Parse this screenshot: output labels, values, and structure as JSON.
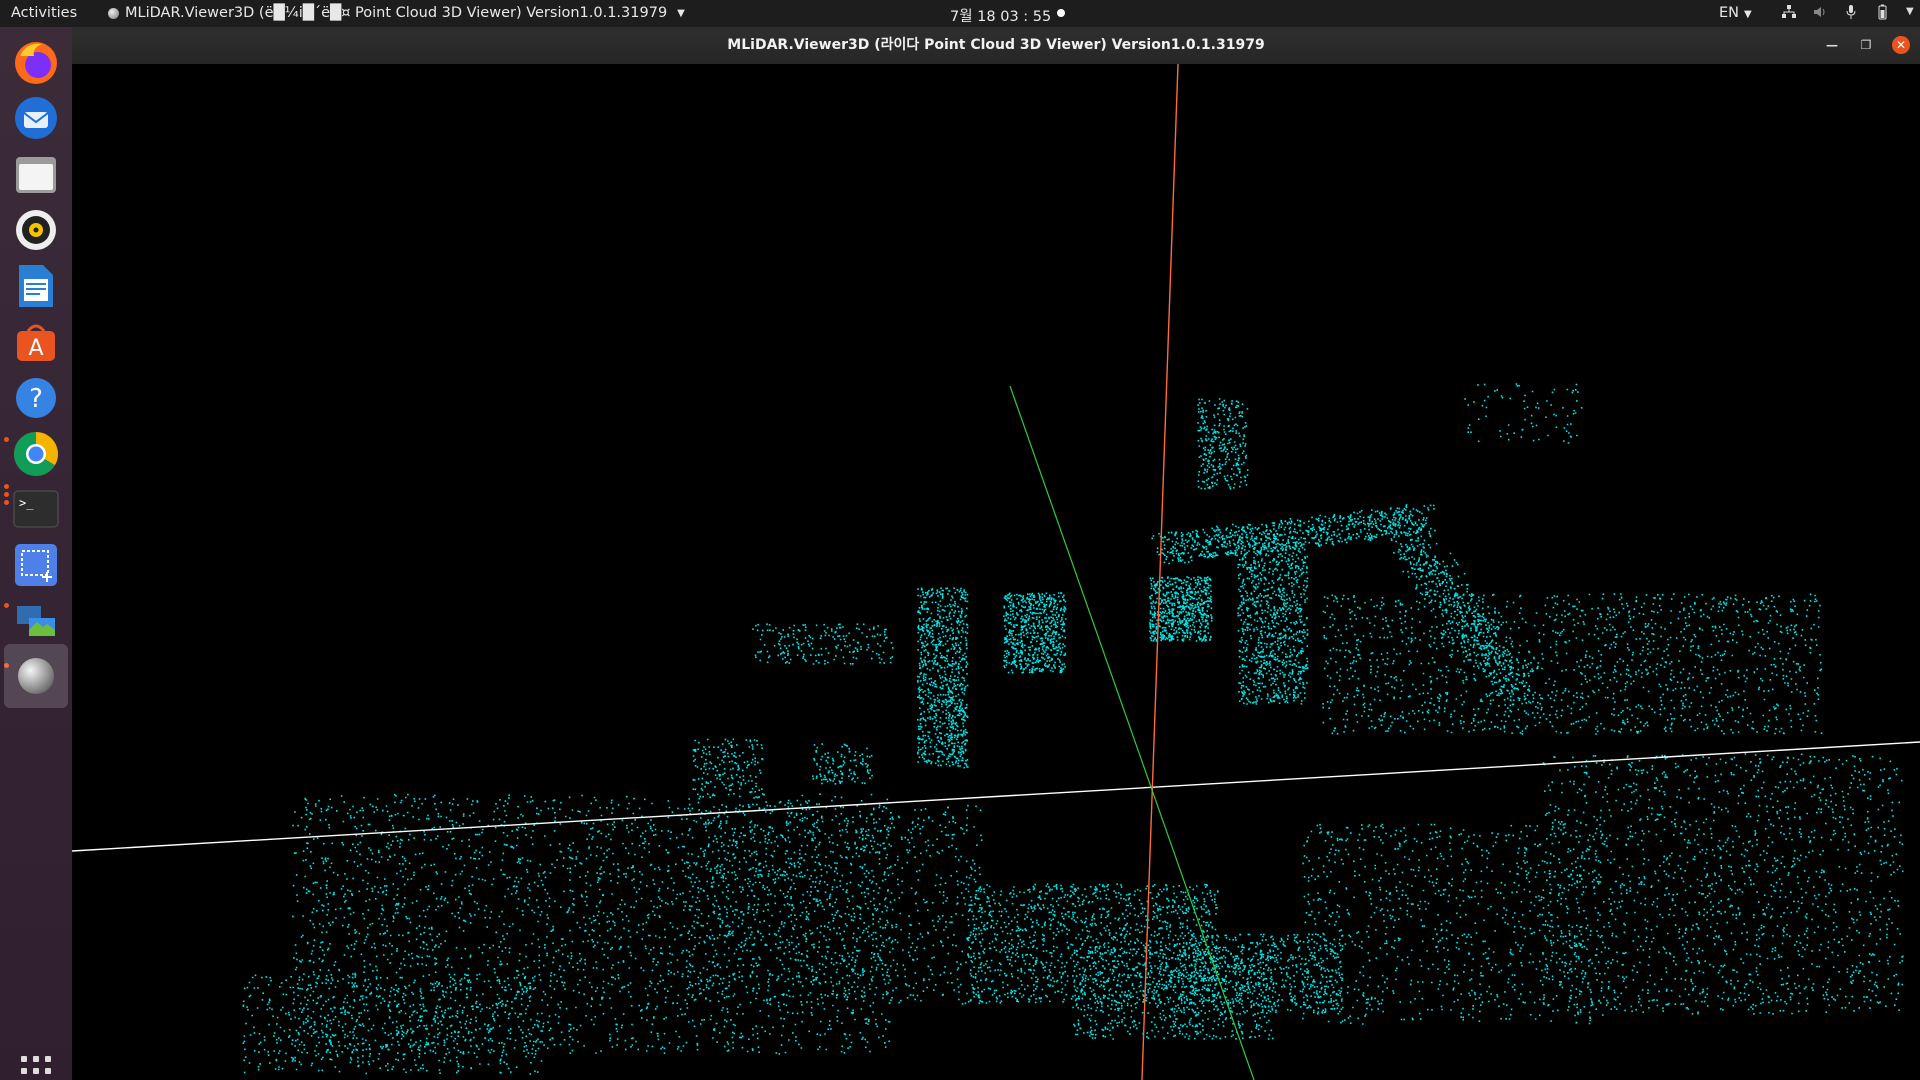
{
  "topbar": {
    "activities": "Activities",
    "app_menu_title": "MLiDAR.Viewer3D (ë█¼i█´ë█¤ Point Cloud 3D Viewer) Version1.0.1.31979",
    "clock": "7월 18  03 : 55",
    "language": "EN"
  },
  "dock": {
    "apps": [
      "firefox",
      "thunderbird",
      "files",
      "rhythmbox",
      "libreoffice-writer",
      "ubuntu-software",
      "help",
      "chrome",
      "terminal",
      "screenshot",
      "remote-desktop",
      "mlidar-viewer"
    ],
    "show_apps": "show-applications"
  },
  "window": {
    "title": "MLiDAR.Viewer3D (라이다 Point Cloud 3D Viewer) Version1.0.1.31979"
  },
  "viewport": {
    "background": "#000000",
    "point_color": "#00e5e5",
    "axis_colors": {
      "x": "#ffffff",
      "y": "#2ecc40",
      "z": "#ff6a3d"
    }
  }
}
